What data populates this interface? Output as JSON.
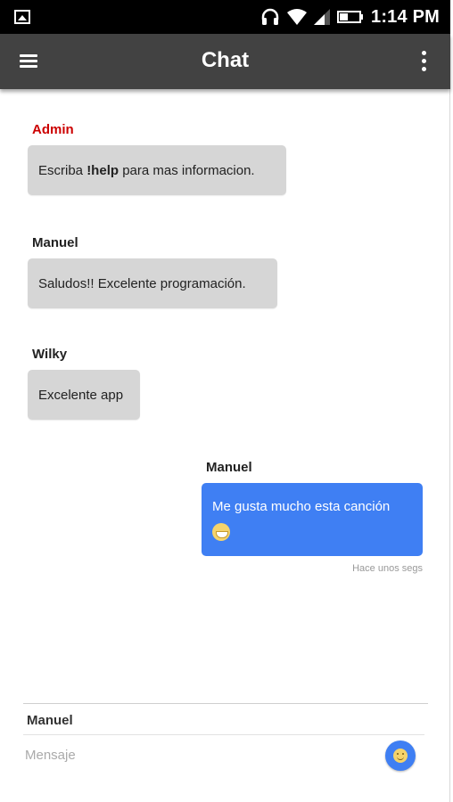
{
  "status_bar": {
    "time": "1:14 PM",
    "icons": [
      "gallery-icon",
      "headphones-icon",
      "wifi-icon",
      "signal-icon",
      "battery-icon"
    ]
  },
  "app_bar": {
    "title": "Chat",
    "icons": [
      "menu-icon",
      "more-vert-icon"
    ],
    "background": "#424242"
  },
  "messages": [
    {
      "sender": "Admin",
      "text_prefix": "Escriba ",
      "text_bold": "!help",
      "text_suffix": " para mas informacion.",
      "direction": "incoming",
      "sender_color": "#cc0000"
    },
    {
      "sender": "Manuel",
      "text": "Saludos!! Excelente programación.",
      "direction": "incoming"
    },
    {
      "sender": "Wilky",
      "text": "Excelente app",
      "direction": "incoming"
    },
    {
      "sender": "Manuel",
      "text": "Me gusta mucho esta canción",
      "emoji": "grin-emoji",
      "timestamp": "Hace unos segs",
      "direction": "outgoing",
      "bubble_color": "#3f7ff3"
    }
  ],
  "composer": {
    "user": "Manuel",
    "placeholder": "Mensaje",
    "value": "",
    "emoji_button_icon": "emoji-icon"
  }
}
